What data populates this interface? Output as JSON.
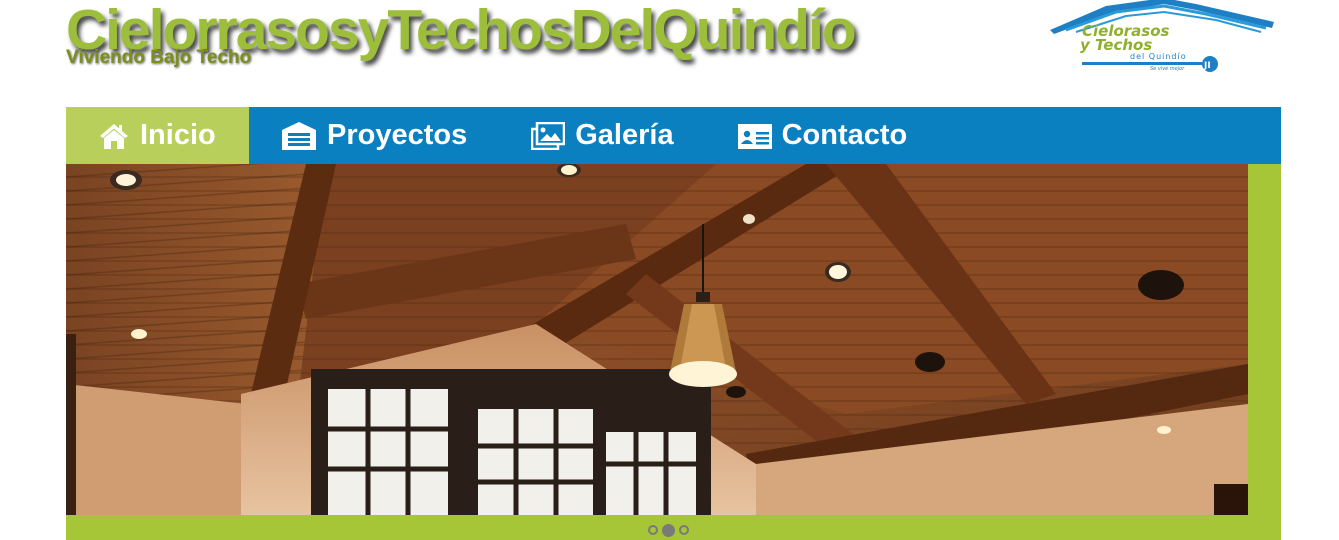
{
  "header": {
    "title": "CielorrasosyTechosDelQuindío",
    "tagline": "Viviendo Bajo Techo"
  },
  "logo": {
    "line1": "Cielorasos",
    "line2": "y Techos",
    "line3": "del Quindío",
    "slogan": "Se vive mejor",
    "badge": "JI"
  },
  "nav": {
    "items": [
      {
        "label": "Inicio",
        "icon": "home-icon",
        "active": true
      },
      {
        "label": "Proyectos",
        "icon": "garage-icon",
        "active": false
      },
      {
        "label": "Galería",
        "icon": "images-icon",
        "active": false
      },
      {
        "label": "Contacto",
        "icon": "contact-card-icon",
        "active": false
      }
    ]
  },
  "slider": {
    "slide_count": 3,
    "active_index": 1
  },
  "colors": {
    "brand_green": "#9dbe3a",
    "nav_blue": "#0a80c0",
    "active_green": "#b8cf5c",
    "frame_green": "#a6c537"
  }
}
